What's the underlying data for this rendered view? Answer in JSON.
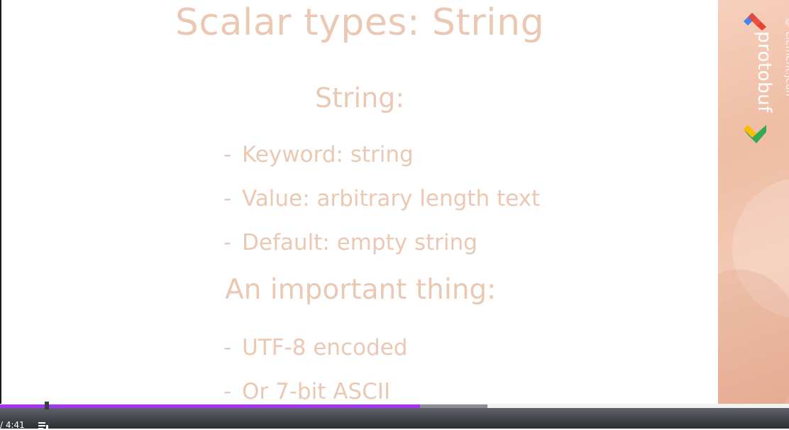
{
  "slide": {
    "title": "Scalar types: String",
    "subheading": "String:",
    "bullet_dash": "-",
    "bullets": [
      "Keyword: string",
      "Value: arbitrary length text",
      "Default: empty string"
    ],
    "important_heading": "An important thing:",
    "important_bullets": [
      "UTF-8 encoded",
      "Or 7-bit ASCII"
    ],
    "text_color": "#ebc8b3"
  },
  "sidebar": {
    "logo_text": "protobuf",
    "copyright": "© clement.jean"
  },
  "player": {
    "time_display": "/ 4:41",
    "played_fraction": 0.532,
    "buffered_fraction": 0.618,
    "progress_color": "#a435f0"
  }
}
